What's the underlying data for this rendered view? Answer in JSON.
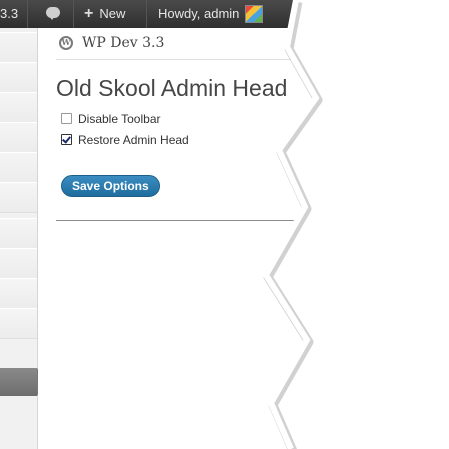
{
  "adminbar": {
    "version": "3.3",
    "new_label": "New",
    "howdy": "Howdy, admin"
  },
  "header": {
    "site_title": "WP Dev 3.3",
    "howdy": "Howdy, admin",
    "caret": "▼"
  },
  "page": {
    "title": "Old Skool Admin Head",
    "options": [
      {
        "label": "Disable Toolbar",
        "checked": false
      },
      {
        "label": "Restore Admin Head",
        "checked": true
      }
    ],
    "save_label": "Save Options"
  },
  "colors": {
    "adminbar": "#464646",
    "button": "#2a7cb0",
    "sidebar": "#f1f1f1"
  },
  "icons": [
    "comment-bubble-icon",
    "plus-icon",
    "avatar-icon",
    "wordpress-logo-icon",
    "dropdown-caret-icon"
  ]
}
